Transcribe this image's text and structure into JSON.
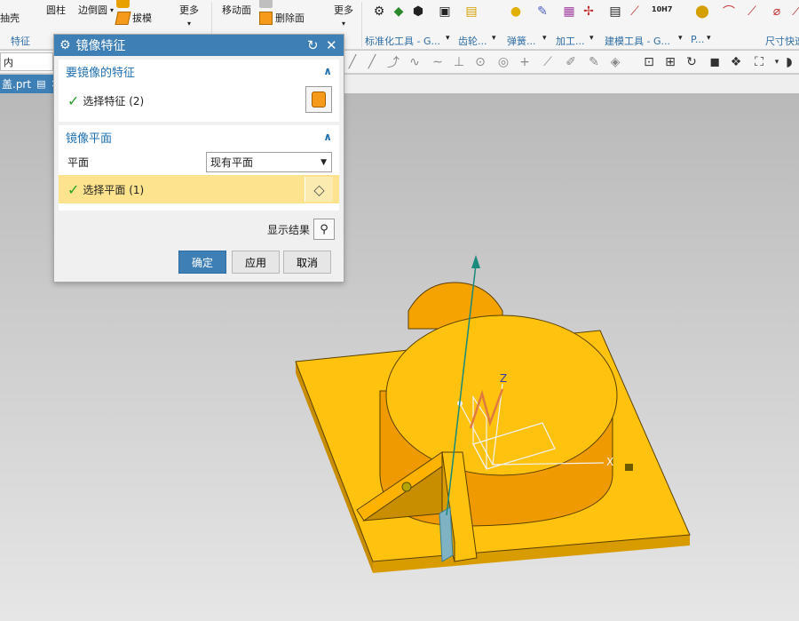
{
  "ribbon": {
    "buttons": [
      "抽壳",
      "圆柱",
      "边倒圆",
      "拔模",
      "更多",
      "移动面",
      "删除面",
      "更多"
    ],
    "groups": [
      "特征",
      "标准化工具 - G...",
      "齿轮...",
      "弹簧...",
      "加工...",
      "建模工具 - G...",
      "P...",
      "尺寸快速"
    ],
    "icon_label_10h7": "10H7"
  },
  "toolbar2": {
    "filter_value": "内"
  },
  "file_tab": {
    "label": "盖.prt"
  },
  "dialog": {
    "title": "镜像特征",
    "section1": {
      "title": "要镜像的特征",
      "select_label": "选择特征 (2)"
    },
    "section2": {
      "title": "镜像平面",
      "plane_label": "平面",
      "plane_value": "现有平面",
      "select_label": "选择平面 (1)"
    },
    "show_result_label": "显示结果",
    "buttons": {
      "ok": "确定",
      "apply": "应用",
      "cancel": "取消"
    }
  },
  "viewport": {
    "axis_x": "X",
    "axis_z": "Z"
  },
  "colors": {
    "accent": "#3e7fb6",
    "part": "#ffc20e",
    "highlight": "#fde38d",
    "axis": "#1a8a7c"
  }
}
